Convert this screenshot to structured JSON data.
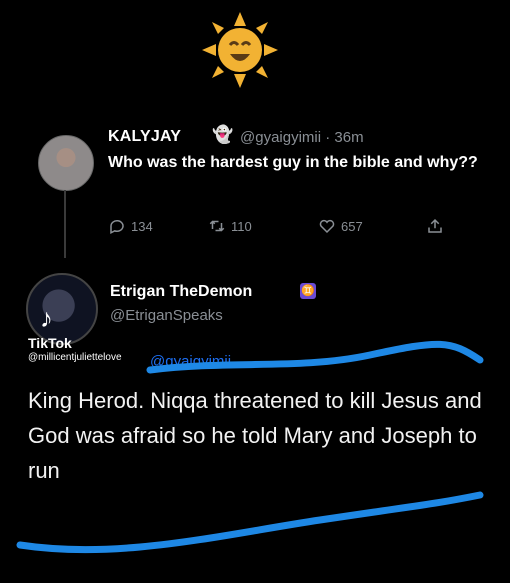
{
  "decoration": {
    "sun_emoji": "smiling-sun-icon"
  },
  "original_tweet": {
    "display_name": "KALYJAY",
    "name_emoji": "👻",
    "handle_and_time": "@gyaigyimii · 36m",
    "text": "Who was the hardest guy in the bible and why??",
    "actions": {
      "replies": "134",
      "retweets": "110",
      "likes": "657"
    }
  },
  "reply_tweet": {
    "display_name": "Etrigan TheDemon",
    "badge": "♊",
    "handle": "@EtriganSpeaks",
    "replying_to_handle": "@gyaigyimii",
    "text": "King Herod. Niqqa threatened to kill Jesus and God was afraid so he told Mary and Joseph to run"
  },
  "watermark": {
    "label": "TikTok",
    "username": "@millicentjuliettelove"
  },
  "colors": {
    "background": "#000000",
    "text": "#ffffff",
    "muted": "#8a8f95",
    "link": "#1d6ef0",
    "scribble": "#1e88e5"
  }
}
